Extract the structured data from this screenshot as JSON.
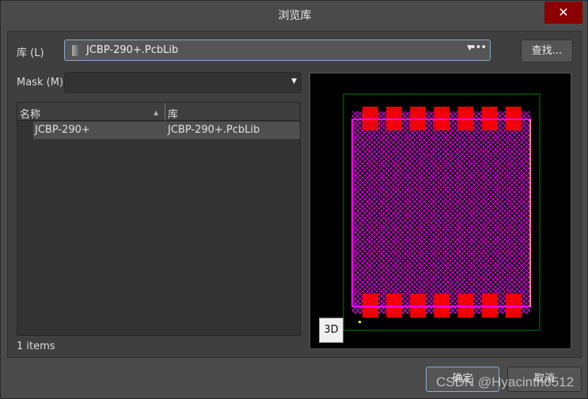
{
  "window": {
    "title": "浏览库",
    "close_icon": "close-icon"
  },
  "library": {
    "label": "库 (L)",
    "value": "JCBP-290+.PcbLib",
    "search_button": "查找..."
  },
  "mask": {
    "label": "Mask (M)",
    "value": ""
  },
  "table": {
    "columns": [
      "名称",
      "库"
    ],
    "rows": [
      {
        "name": "JCBP-290+",
        "library": "JCBP-290+.PcbLib"
      }
    ]
  },
  "status": "1 items",
  "preview": {
    "button_3d": "3D",
    "colors": {
      "pad": "#ff0000",
      "body": "#ff00ff",
      "outline": "#008000",
      "silk": "#ffff00"
    }
  },
  "footer": {
    "ok": "确定",
    "cancel": "取消"
  },
  "watermark": "CSDN @Hyacinth0512"
}
